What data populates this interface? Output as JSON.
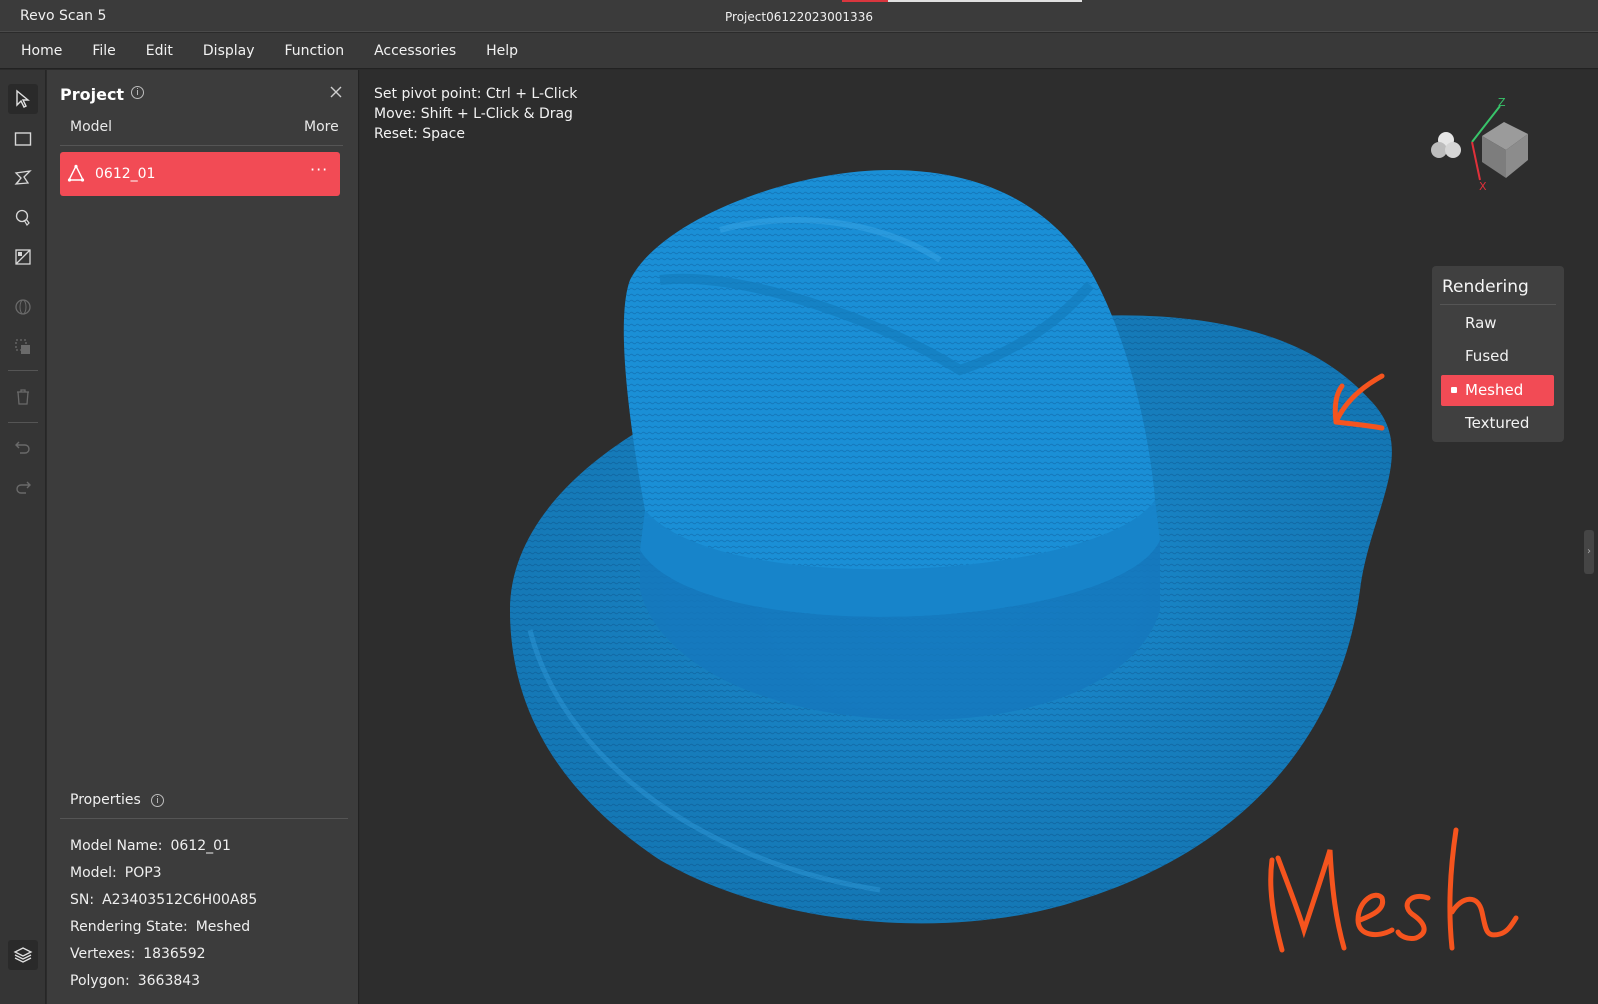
{
  "window": {
    "app_title": "Revo Scan 5",
    "project_title": "Project06122023001336"
  },
  "menu": [
    "Home",
    "File",
    "Edit",
    "Display",
    "Function",
    "Accessories",
    "Help"
  ],
  "toolbar": {
    "tools": [
      "select-arrow-icon",
      "rectangle-select-icon",
      "lasso-select-icon",
      "brush-select-icon",
      "invert-select-icon",
      "sphere-icon",
      "copy-layer-icon",
      "trash-icon",
      "undo-icon",
      "redo-icon",
      "layers-icon"
    ]
  },
  "project_panel": {
    "title": "Project",
    "info_glyph": "i",
    "columns": {
      "model": "Model",
      "more": "More"
    },
    "models": [
      {
        "name": "0612_01",
        "more_glyph": "···",
        "selected": true
      }
    ]
  },
  "properties": {
    "title": "Properties",
    "items": [
      {
        "key": "Model Name:",
        "value": "0612_01"
      },
      {
        "key": "Model:",
        "value": "POP3"
      },
      {
        "key": "SN:",
        "value": "A23403512C6H00A85"
      },
      {
        "key": "Rendering State:",
        "value": "Meshed"
      },
      {
        "key": "Vertexes:",
        "value": "1836592"
      },
      {
        "key": "Polygon:",
        "value": "3663843"
      }
    ]
  },
  "viewport": {
    "hints": [
      "Set pivot point: Ctrl + L-Click",
      "Move: Shift + L-Click & Drag",
      "Reset: Space"
    ],
    "mesh_color": "#1a8fd6",
    "accent_color": "#f24b55",
    "annotation_color": "#f5541e",
    "annotation_text": "Mesh",
    "axis_labels": {
      "z": "Z",
      "x": "X"
    },
    "side_handle_glyph": "›"
  },
  "rendering": {
    "title": "Rendering",
    "options": [
      "Raw",
      "Fused",
      "Meshed",
      "Textured"
    ],
    "selected": "Meshed"
  }
}
